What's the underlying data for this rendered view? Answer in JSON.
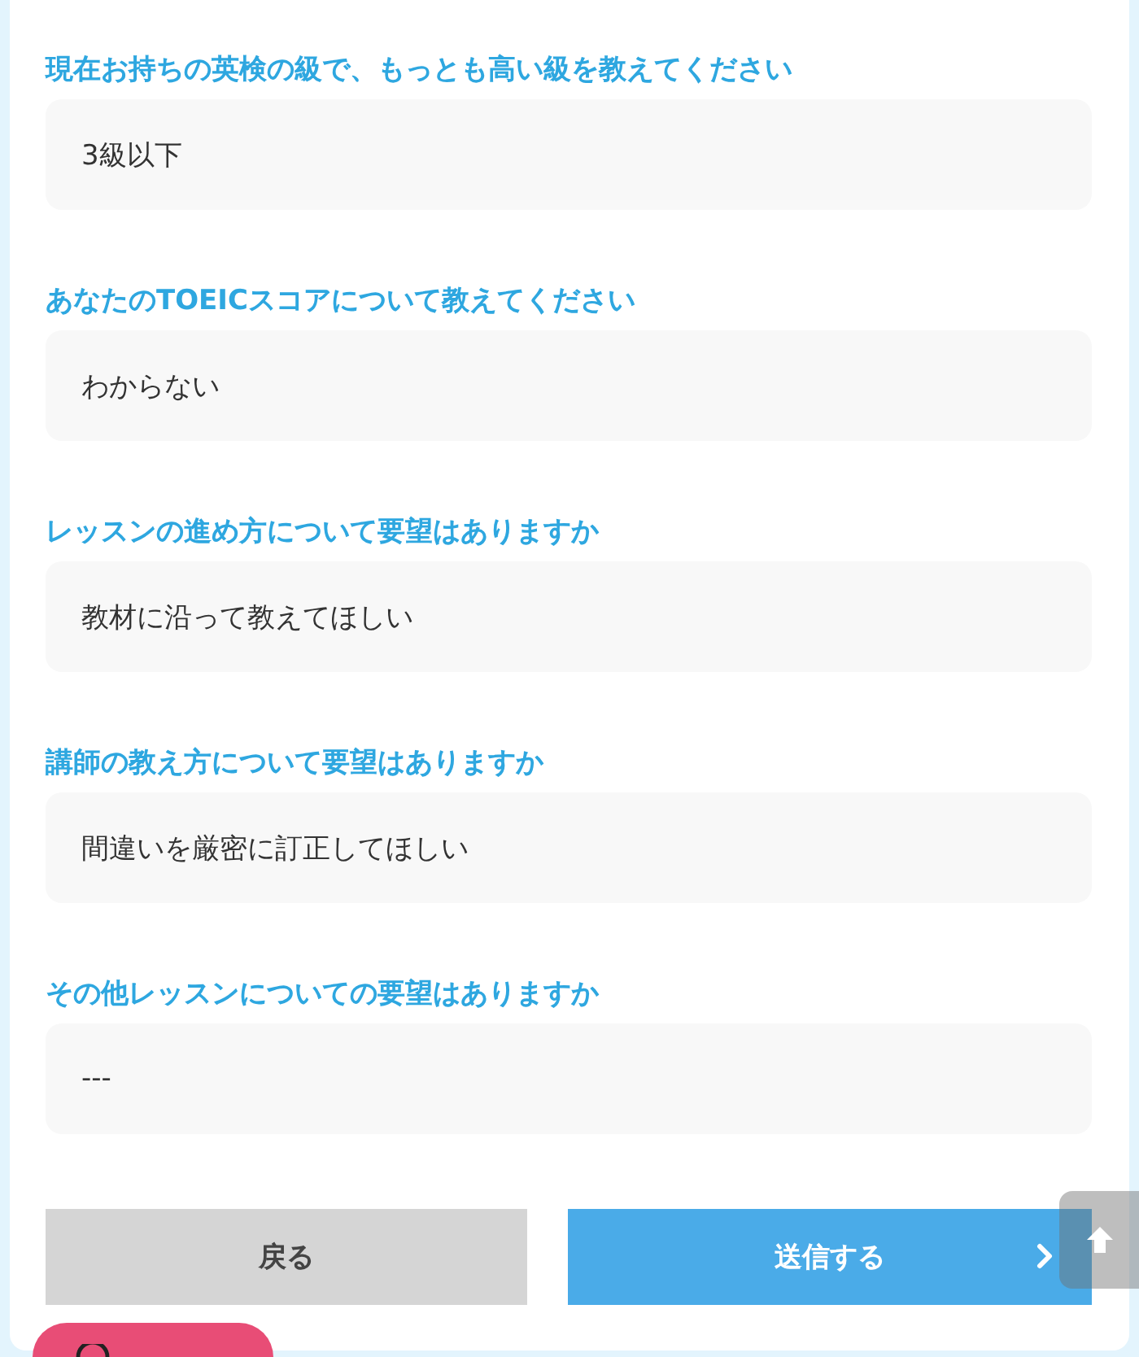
{
  "questions": [
    {
      "label": "現在お持ちの英検の級で、もっとも高い級を教えてください",
      "answer": "3級以下"
    },
    {
      "label": "あなたのTOEICスコアについて教えてください",
      "answer": "わからない"
    },
    {
      "label": "レッスンの進め方について要望はありますか",
      "answer": "教材に沿って教えてほしい"
    },
    {
      "label": "講師の教え方について要望はありますか",
      "answer": "間違いを厳密に訂正してほしい"
    },
    {
      "label": "その他レッスンについての要望はありますか",
      "answer": "---"
    }
  ],
  "buttons": [
    {
      "kind": "back",
      "label": "戻る"
    },
    {
      "kind": "submit",
      "label": "送信する"
    }
  ]
}
